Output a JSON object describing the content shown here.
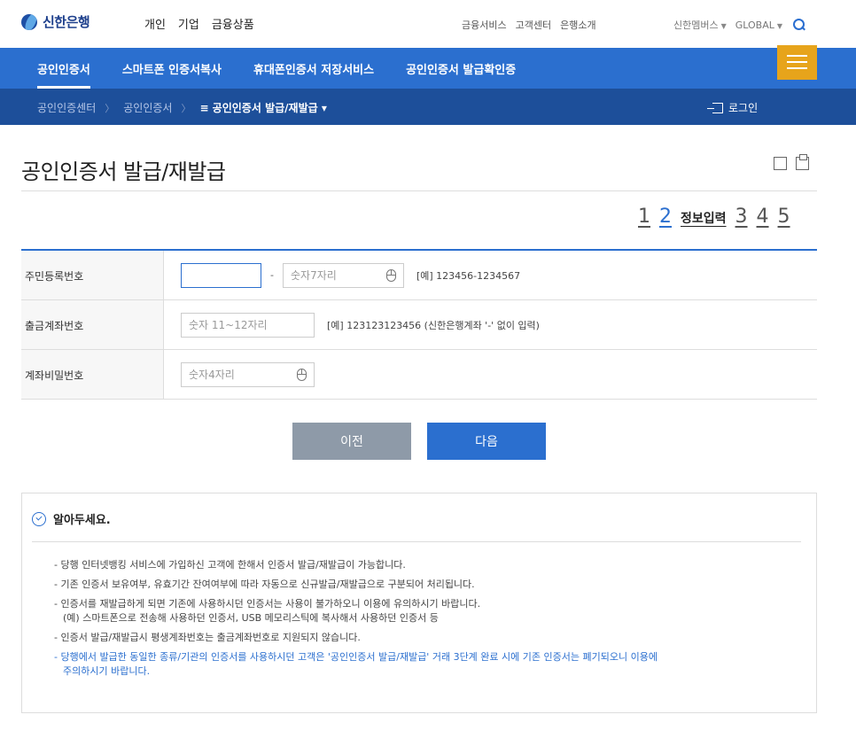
{
  "brand": {
    "name": "신한은행"
  },
  "gnb": [
    "개인",
    "기업",
    "금융상품"
  ],
  "util": [
    "금융서비스",
    "고객센터",
    "은행소개"
  ],
  "util2": {
    "member": "신한멤버스",
    "global": "GLOBAL"
  },
  "nav": [
    "공인인증서",
    "스마트폰 인증서복사",
    "휴대폰인증서 저장서비스",
    "공인인증서 발급확인증"
  ],
  "breadcrumb": {
    "items": [
      "공인인증센터",
      "공인인증서"
    ],
    "current": "≡ 공인인증서 발급/재발급 ▾",
    "login": "로그인"
  },
  "page": {
    "title": "공인인증서 발급/재발급"
  },
  "steps": {
    "items": [
      "1",
      "2",
      "3",
      "4",
      "5"
    ],
    "active_label": "정보입력"
  },
  "form": {
    "rows": [
      {
        "label": "주민등록번호",
        "input1": "",
        "dash": "-",
        "input2_placeholder": "숫자7자리",
        "example": "[예] 123456-1234567"
      },
      {
        "label": "출금계좌번호",
        "input_placeholder": "숫자 11~12자리",
        "example": "[예] 123123123456 (신한은행계좌 '-' 없이 입력)"
      },
      {
        "label": "계좌비밀번호",
        "input_placeholder": "숫자4자리"
      }
    ]
  },
  "buttons": {
    "prev": "이전",
    "next": "다음"
  },
  "notice": {
    "title": "알아두세요.",
    "items": [
      {
        "text": "- 당행 인터넷뱅킹 서비스에 가입하신 고객에 한해서 인증서 발급/재발급이 가능합니다."
      },
      {
        "text": "- 기존 인증서 보유여부, 유효기간 잔여여부에 따라 자동으로 신규발급/재발급으로 구분되어 처리됩니다."
      },
      {
        "text": "- 인증서를 재발급하게 되면 기존에 사용하시던 인증서는 사용이 불가하오니 이용에 유의하시기 바랍니다.",
        "sub": "(예) 스마트폰으로 전송해 사용하던 인증서, USB 메모리스틱에 복사해서 사용하던 인증서 등"
      },
      {
        "text": "- 인증서 발급/재발급시 평생계좌번호는 출금계좌번호로 지원되지 않습니다."
      },
      {
        "text": "- 당행에서 발급한 동일한 종류/기관의 인증서를 사용하시던 고객은 '공인인증서 발급/재발급' 거래 3단계 완료 시에 기존 인증서는 폐기되오니 이용에",
        "sub": "주의하시기 바랍니다.",
        "highlight": true
      }
    ]
  },
  "colors": {
    "primary": "#2b6fcf",
    "dark_nav": "#1d4f9a",
    "menu": "#e7a41b"
  }
}
